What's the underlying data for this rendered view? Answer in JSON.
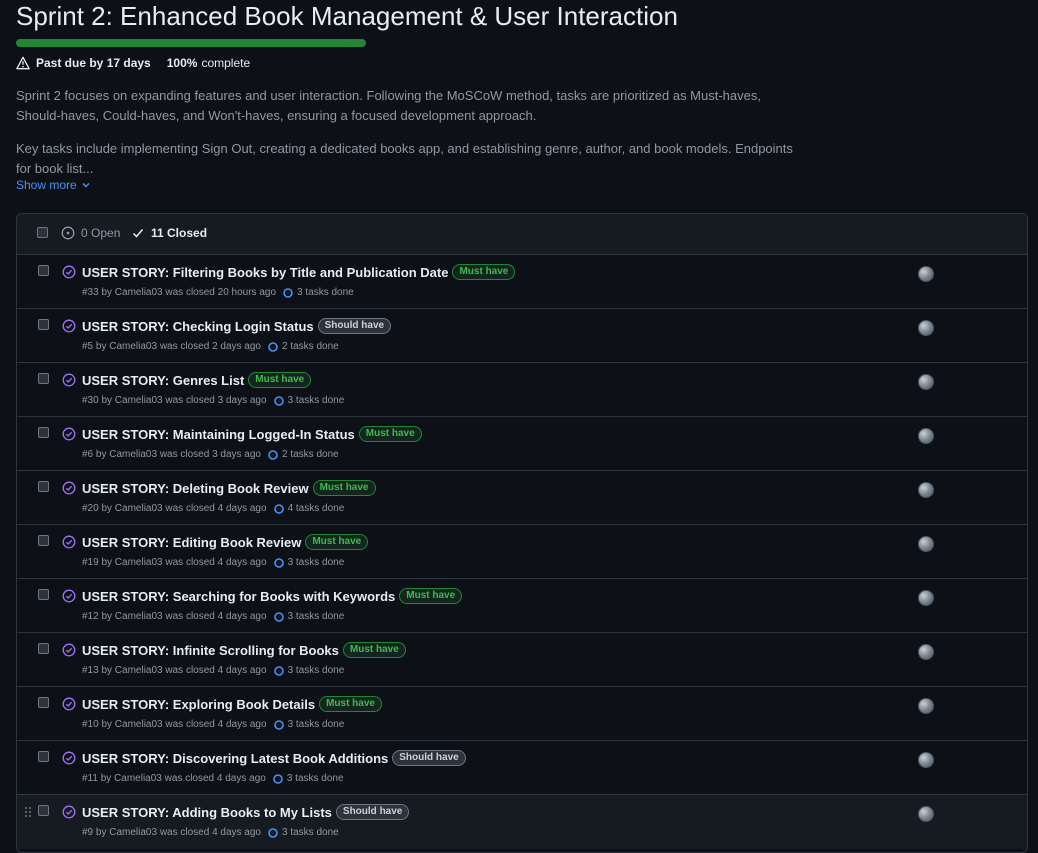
{
  "milestone": {
    "title": "Sprint 2: Enhanced Book Management & User Interaction",
    "progress_percent": 100,
    "due_text": "Past due by 17 days",
    "complete_pct": "100%",
    "complete_suffix": "complete",
    "description_p1": "Sprint 2 focuses on expanding features and user interaction. Following the MoSCoW method, tasks are prioritized as Must-haves, Should-haves, Could-haves, and Won't-haves, ensuring a focused development approach.",
    "description_p2": "Key tasks include implementing Sign Out, creating a dedicated books app, and establishing genre, author, and book models. Endpoints for book list...",
    "show_more": "Show more"
  },
  "colors": {
    "background": "#0d1117",
    "progress": "#238636",
    "closed_icon": "#a371f7",
    "link": "#4493f8",
    "must_label": "#3fb950"
  },
  "header": {
    "open_label": "0 Open",
    "closed_label": "11 Closed"
  },
  "issues": [
    {
      "title": "USER STORY: Filtering Books by Title and Publication Date",
      "label": "Must have",
      "label_type": "must",
      "meta": "#33 by Camelia03 was closed 20 hours ago",
      "tasks": "3 tasks done"
    },
    {
      "title": "USER STORY: Checking Login Status",
      "label": "Should have",
      "label_type": "should",
      "meta": "#5 by Camelia03 was closed 2 days ago",
      "tasks": "2 tasks done"
    },
    {
      "title": "USER STORY: Genres List",
      "label": "Must have",
      "label_type": "must",
      "meta": "#30 by Camelia03 was closed 3 days ago",
      "tasks": "3 tasks done"
    },
    {
      "title": "USER STORY: Maintaining Logged-In Status",
      "label": "Must have",
      "label_type": "must",
      "meta": "#6 by Camelia03 was closed 3 days ago",
      "tasks": "2 tasks done"
    },
    {
      "title": "USER STORY: Deleting Book Review",
      "label": "Must have",
      "label_type": "must",
      "meta": "#20 by Camelia03 was closed 4 days ago",
      "tasks": "4 tasks done"
    },
    {
      "title": "USER STORY: Editing Book Review",
      "label": "Must have",
      "label_type": "must",
      "meta": "#19 by Camelia03 was closed 4 days ago",
      "tasks": "3 tasks done"
    },
    {
      "title": "USER STORY: Searching for Books with Keywords",
      "label": "Must have",
      "label_type": "must",
      "meta": "#12 by Camelia03 was closed 4 days ago",
      "tasks": "3 tasks done"
    },
    {
      "title": "USER STORY: Infinite Scrolling for Books",
      "label": "Must have",
      "label_type": "must",
      "meta": "#13 by Camelia03 was closed 4 days ago",
      "tasks": "3 tasks done"
    },
    {
      "title": "USER STORY: Exploring Book Details",
      "label": "Must have",
      "label_type": "must",
      "meta": "#10 by Camelia03 was closed 4 days ago",
      "tasks": "3 tasks done"
    },
    {
      "title": "USER STORY: Discovering Latest Book Additions",
      "label": "Should have",
      "label_type": "should",
      "meta": "#11 by Camelia03 was closed 4 days ago",
      "tasks": "3 tasks done"
    },
    {
      "title": "USER STORY: Adding Books to My Lists",
      "label": "Should have",
      "label_type": "should",
      "meta": "#9 by Camelia03 was closed 4 days ago",
      "tasks": "3 tasks done"
    }
  ]
}
